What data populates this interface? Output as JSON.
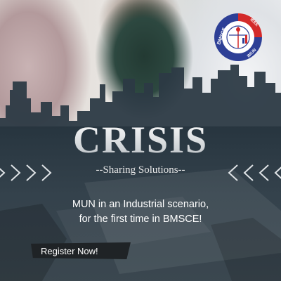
{
  "title": "CRISIS",
  "subtitle": "--Sharing Solutions--",
  "tagline": {
    "line1": "MUN in an Industrial scenario,",
    "line2": "for the first time in BMSCE!"
  },
  "cta_label": "Register Now!",
  "logo": {
    "left_text": "BMSCE",
    "right_text": "IEEE",
    "bottom_text": "IMUN"
  },
  "colors": {
    "overlay": "#2e3c47",
    "logo_red": "#d32a2a",
    "logo_blue": "#2d3f96",
    "cta_bg": "#1f2326"
  }
}
